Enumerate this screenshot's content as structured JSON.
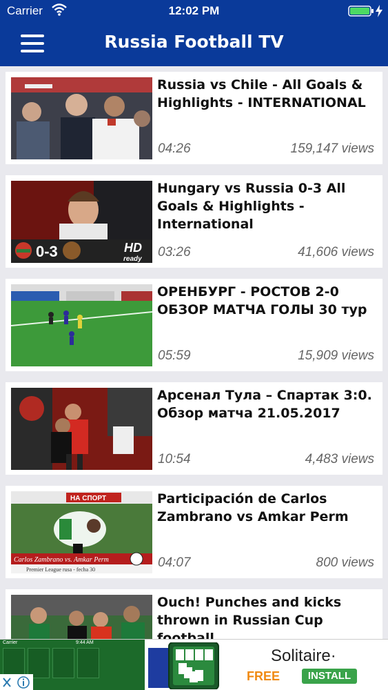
{
  "status_bar": {
    "carrier": "Carrier",
    "time": "12:02 PM"
  },
  "nav_bar": {
    "title": "Russia Football TV"
  },
  "videos": [
    {
      "title": "Russia vs Chile - All Goals & Highlights -  INTERNATIONAL",
      "duration": "04:26",
      "views": "159,147 views"
    },
    {
      "title": "Hungary vs Russia 0-3 All Goals & Highlights - International",
      "duration": "03:26",
      "views": "41,606 views",
      "thumb_score": "0-3",
      "thumb_badge_main": "HD",
      "thumb_badge_sub": "ready"
    },
    {
      "title": "ОРЕНБУРГ - РОСТОВ 2-0 ОБЗОР МАТЧА ГОЛЫ 30 тур",
      "duration": "05:59",
      "views": "15,909 views"
    },
    {
      "title": "Арсенал Тула – Спартак 3:0. Обзор матча 21.05.2017",
      "duration": "10:54",
      "views": "4,483 views"
    },
    {
      "title": "Participación de Carlos Zambrano vs  Amkar Perm",
      "duration": "04:07",
      "views": "800 views",
      "thumb_caption": "Carlos Zambrano vs. Amkar Perm",
      "thumb_subcaption": "Premier League rusa - fecha 30",
      "thumb_banner": "НА СПОРТ"
    },
    {
      "title": "Ouch! Punches and kicks thrown in Russian Cup football",
      "duration": "",
      "views": ""
    }
  ],
  "ad": {
    "mini_carrier": "Carrier",
    "mini_time": "9:44 AM",
    "title": "Solitaire·",
    "free_label": "FREE",
    "install_label": "INSTALL"
  },
  "colors": {
    "header_bg": "#0a3a9a",
    "page_bg": "#e9e9ee",
    "card_bg": "#ffffff",
    "meta_text": "#666666",
    "ad_free": "#f08a12",
    "ad_install": "#3aa34a"
  },
  "icons": {
    "menu": "hamburger-menu-icon",
    "wifi": "wifi-icon",
    "battery": "battery-icon",
    "charging": "charging-bolt-icon",
    "ad_info": "ad-info-icon",
    "ad_close": "ad-close-icon"
  }
}
